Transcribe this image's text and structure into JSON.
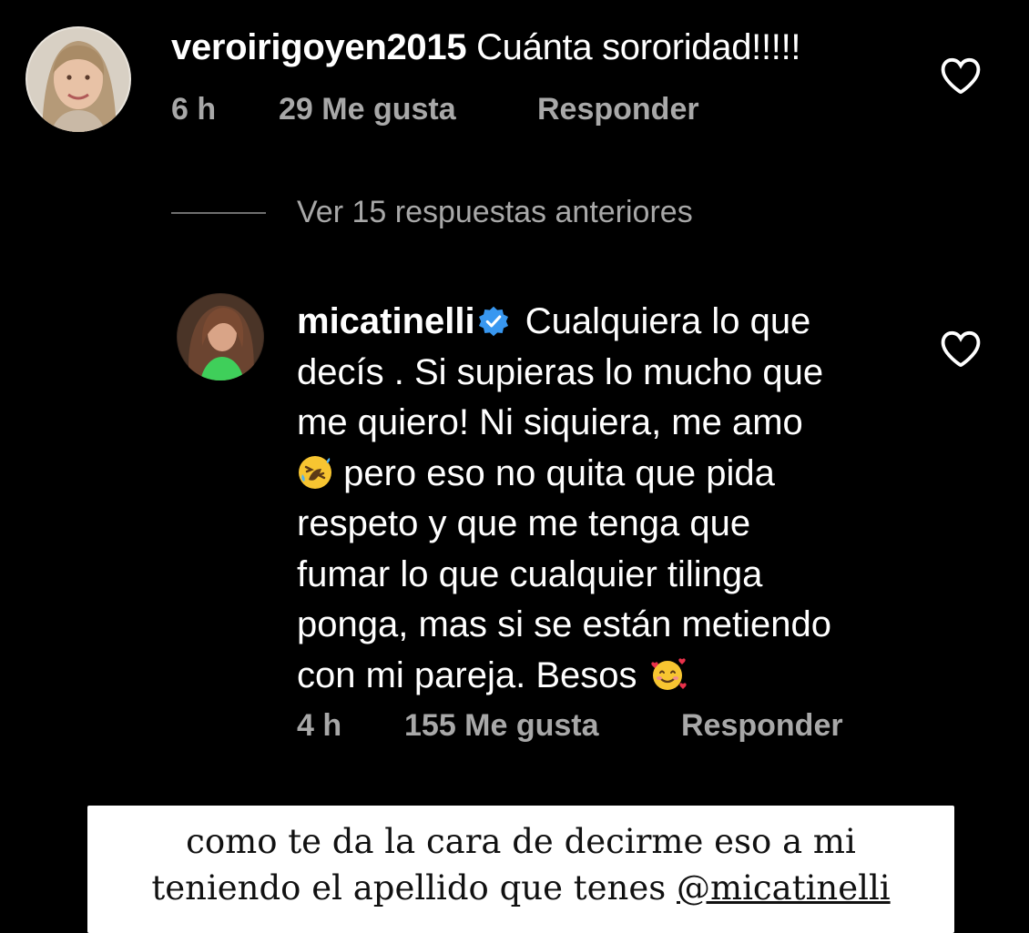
{
  "comment": {
    "username": "veroirigoyen2015",
    "text": "Cuánta sororidad!!!!!",
    "time": "6 h",
    "likes": "29 Me gusta",
    "reply_label": "Responder",
    "like_icon": "heart-outline-icon"
  },
  "view_replies": {
    "label": "Ver 15 respuestas anteriores"
  },
  "reply": {
    "username": "micatinelli",
    "verified_icon": "verified-badge-icon",
    "text_part1": "Cualquiera lo que\ndecís . Si supieras lo mucho que\nme quiero! Ni siquiera, me amo\n",
    "emoji1": "rolling-on-floor-laughing-emoji",
    "text_part2": " pero eso no quita que pida\nrespeto y que me tenga que\nfumar lo que cualquier tilinga\nponga, mas si se están metiendo\ncon mi pareja. Besos ",
    "emoji2": "smiling-face-with-hearts-emoji",
    "time": "4 h",
    "likes": "155 Me gusta",
    "reply_label": "Responder",
    "like_icon": "heart-outline-icon"
  },
  "caption": {
    "line1": "como te da la cara de decirme eso a mi",
    "line2_prefix": "teniendo el apellido que tenes ",
    "mention": "@micatinelli"
  },
  "colors": {
    "background": "#000000",
    "text_primary": "#ffffff",
    "text_secondary": "#a8a8a8",
    "verified_blue": "#3897f0",
    "caption_bg": "#ffffff",
    "caption_text": "#111111"
  }
}
